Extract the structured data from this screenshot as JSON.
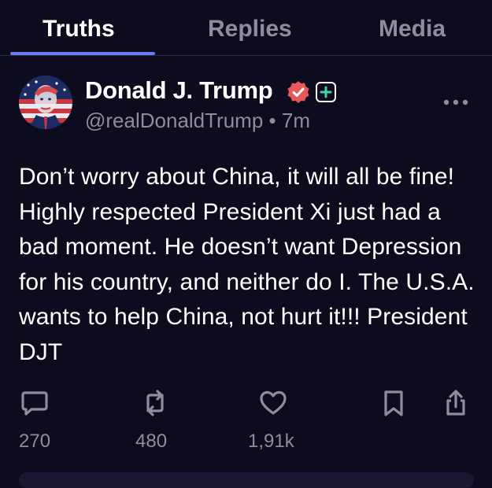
{
  "tabs": [
    {
      "label": "Truths",
      "active": true
    },
    {
      "label": "Replies",
      "active": false
    },
    {
      "label": "Media",
      "active": false
    }
  ],
  "post": {
    "author_name": "Donald J. Trump",
    "handle": "@realDonaldTrump",
    "separator": "•",
    "time": "7m",
    "text": "Don’t worry about China, it will all be fine! Highly respected President Xi just had a bad moment. He doesn’t want Depression for his country, and neither do I. The U.S.A. wants to help China, not hurt it!!! President DJT",
    "verified_icon": "verified-badge-icon",
    "plus_icon": "plus-square-icon"
  },
  "actions": [
    {
      "name": "reply",
      "icon": "speech-bubble-icon",
      "count": "270"
    },
    {
      "name": "retruth",
      "icon": "repost-arrows-icon",
      "count": "480"
    },
    {
      "name": "like",
      "icon": "heart-icon",
      "count": "1,91k"
    },
    {
      "name": "bookmark",
      "icon": "bookmark-icon",
      "count": ""
    },
    {
      "name": "share",
      "icon": "share-icon",
      "count": ""
    }
  ],
  "colors": {
    "background": "#0d0b1e",
    "accent": "#6b7bf0",
    "muted": "#8e8ba3",
    "verified": "#e8585a"
  }
}
